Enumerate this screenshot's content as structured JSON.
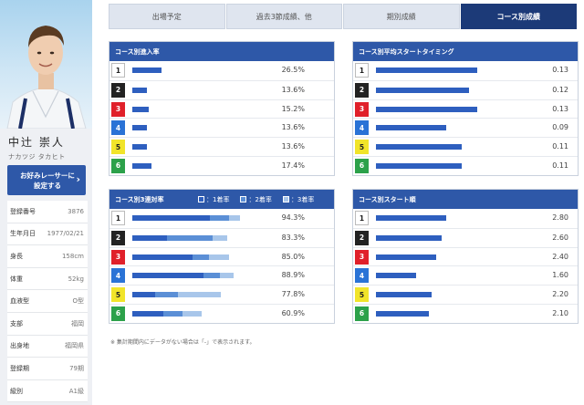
{
  "profile": {
    "name": "中辻 崇人",
    "kana": "ナカツジ タカヒト",
    "favorite_button": "お好みレーサーに\n設定する",
    "info": [
      {
        "label": "登録番号",
        "value": "3876"
      },
      {
        "label": "生年月日",
        "value": "1977/02/21"
      },
      {
        "label": "身長",
        "value": "158cm"
      },
      {
        "label": "体重",
        "value": "52kg"
      },
      {
        "label": "血液型",
        "value": "O型"
      },
      {
        "label": "支部",
        "value": "福岡"
      },
      {
        "label": "出身地",
        "value": "福岡県"
      },
      {
        "label": "登録期",
        "value": "79期"
      },
      {
        "label": "級別",
        "value": "A1級"
      }
    ]
  },
  "tabs": [
    {
      "label": "出場予定",
      "active": false
    },
    {
      "label": "過去3節成績、他",
      "active": false
    },
    {
      "label": "期別成績",
      "active": false
    },
    {
      "label": "コース別成績",
      "active": true
    }
  ],
  "lane_colors": [
    {
      "bg": "#ffffff",
      "fg": "#222222",
      "border": "#bbbbbb"
    },
    {
      "bg": "#222222",
      "fg": "#ffffff",
      "border": "#222222"
    },
    {
      "bg": "#e0202a",
      "fg": "#ffffff",
      "border": "#e0202a"
    },
    {
      "bg": "#2a73d6",
      "fg": "#ffffff",
      "border": "#2a73d6"
    },
    {
      "bg": "#f1e42a",
      "fg": "#222222",
      "border": "#f1e42a"
    },
    {
      "bg": "#2ca14a",
      "fg": "#ffffff",
      "border": "#2ca14a"
    }
  ],
  "bar_colors": {
    "first": "#2e5fbf",
    "second": "#5b8fd6",
    "third": "#a8c6ea"
  },
  "panels": {
    "entry": {
      "title": "コース別進入率",
      "rows": [
        {
          "lane": "1",
          "value": 26.5,
          "label": "26.5%"
        },
        {
          "lane": "2",
          "value": 13.6,
          "label": "13.6%"
        },
        {
          "lane": "3",
          "value": 15.2,
          "label": "15.2%"
        },
        {
          "lane": "4",
          "value": 13.6,
          "label": "13.6%"
        },
        {
          "lane": "5",
          "value": 13.6,
          "label": "13.6%"
        },
        {
          "lane": "6",
          "value": 17.4,
          "label": "17.4%"
        }
      ]
    },
    "st_timing": {
      "title": "コース別平均スタートタイミング",
      "rows": [
        {
          "lane": "1",
          "value": 0.13,
          "label": "0.13"
        },
        {
          "lane": "2",
          "value": 0.12,
          "label": "0.12"
        },
        {
          "lane": "3",
          "value": 0.13,
          "label": "0.13"
        },
        {
          "lane": "4",
          "value": 0.09,
          "label": "0.09"
        },
        {
          "lane": "5",
          "value": 0.11,
          "label": "0.11"
        },
        {
          "lane": "6",
          "value": 0.11,
          "label": "0.11"
        }
      ]
    },
    "top3": {
      "title": "コース別3連対率",
      "legend": [
        "：1着率",
        "：2着率",
        "：3着率"
      ],
      "rows": [
        {
          "lane": "1",
          "first": 68.0,
          "second": 17.0,
          "third": 9.3,
          "label": "94.3%"
        },
        {
          "lane": "2",
          "first": 30.0,
          "second": 40.0,
          "third": 13.3,
          "label": "83.3%"
        },
        {
          "lane": "3",
          "first": 53.0,
          "second": 14.0,
          "third": 18.0,
          "label": "85.0%"
        },
        {
          "lane": "4",
          "first": 62.0,
          "second": 15.0,
          "third": 11.9,
          "label": "88.9%"
        },
        {
          "lane": "5",
          "first": 20.0,
          "second": 20.0,
          "third": 37.8,
          "label": "77.8%"
        },
        {
          "lane": "6",
          "first": 27.0,
          "second": 17.0,
          "third": 16.9,
          "label": "60.9%"
        }
      ]
    },
    "st_rank": {
      "title": "コース別スタート順",
      "rows": [
        {
          "lane": "1",
          "value": 2.8,
          "label": "2.80"
        },
        {
          "lane": "2",
          "value": 2.6,
          "label": "2.60"
        },
        {
          "lane": "3",
          "value": 2.4,
          "label": "2.40"
        },
        {
          "lane": "4",
          "value": 1.6,
          "label": "1.60"
        },
        {
          "lane": "5",
          "value": 2.2,
          "label": "2.20"
        },
        {
          "lane": "6",
          "value": 2.1,
          "label": "2.10"
        }
      ]
    }
  },
  "note": "※ 集計期間内にデータがない場合は「-」で表示されます。"
}
